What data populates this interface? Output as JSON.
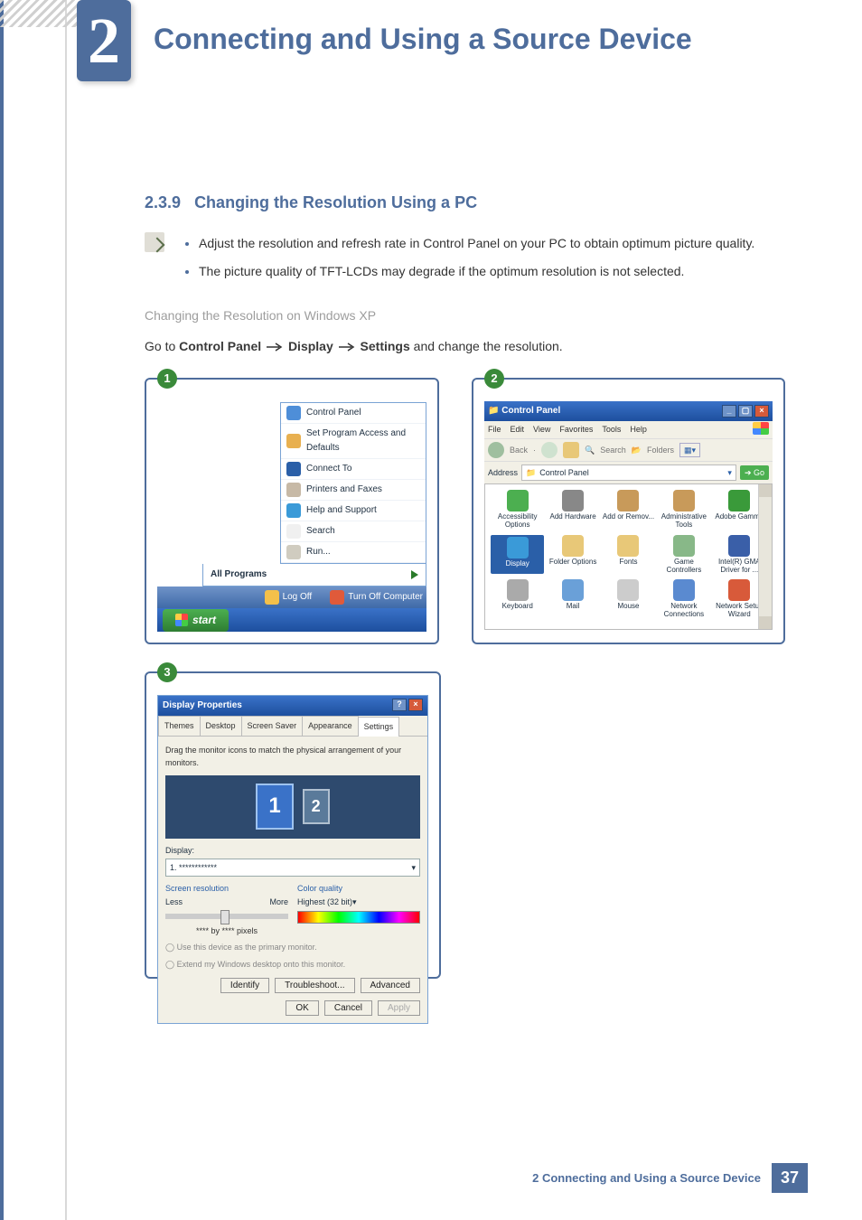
{
  "chapter": {
    "num": "2",
    "title": "Connecting and Using a Source Device"
  },
  "section": {
    "num": "2.3.9",
    "title": "Changing the Resolution Using a PC"
  },
  "bullets": [
    "Adjust the resolution and refresh rate in Control Panel on your PC to obtain optimum picture quality.",
    "The picture quality of TFT-LCDs may degrade if the optimum resolution is not selected."
  ],
  "subhead": "Changing the Resolution on Windows XP",
  "goline": {
    "pre": "Go to ",
    "a": "Control Panel",
    "b": "Display",
    "c": "Settings",
    "post": " and change the resolution."
  },
  "panel1": {
    "badge": "1",
    "menu": [
      {
        "label": "Control Panel",
        "color": "#4e8ed8"
      },
      {
        "label": "Set Program Access and Defaults",
        "color": "#e8b050"
      },
      {
        "label": "Connect To",
        "color": "#2a5fa8"
      },
      {
        "label": "Printers and Faxes",
        "color": "#c7b9a6"
      },
      {
        "label": "Help and Support",
        "color": "#3a9ad8"
      },
      {
        "label": "Search",
        "color": "#f0f0f0"
      },
      {
        "label": "Run...",
        "color": "#d0ccc0"
      }
    ],
    "allprograms": "All Programs",
    "logoff": "Log Off",
    "turnoff": "Turn Off Computer",
    "start": "start"
  },
  "panel2": {
    "badge": "2",
    "title": "Control Panel",
    "menubar": [
      "File",
      "Edit",
      "View",
      "Favorites",
      "Tools",
      "Help"
    ],
    "back": "Back",
    "search": "Search",
    "folders": "Folders",
    "addr_label": "Address",
    "addr_value": "Control Panel",
    "go": "Go",
    "items": [
      {
        "label": "Accessibility Options",
        "color": "#4caf50"
      },
      {
        "label": "Add Hardware",
        "color": "#888"
      },
      {
        "label": "Add or Remov...",
        "color": "#c89a5a"
      },
      {
        "label": "Administrative Tools",
        "color": "#c89a5a"
      },
      {
        "label": "Adobe Gamma",
        "color": "#3a9a3a"
      },
      {
        "label": "Display",
        "color": "#3a9ad8",
        "selected": true
      },
      {
        "label": "Folder Options",
        "color": "#e8c878"
      },
      {
        "label": "Fonts",
        "color": "#e8c878"
      },
      {
        "label": "Game Controllers",
        "color": "#88b888"
      },
      {
        "label": "Intel(R) GMA Driver for ...",
        "color": "#3a5fa8"
      },
      {
        "label": "Keyboard",
        "color": "#aaa"
      },
      {
        "label": "Mail",
        "color": "#6aa0d8"
      },
      {
        "label": "Mouse",
        "color": "#ccc"
      },
      {
        "label": "Network Connections",
        "color": "#5a8ad0"
      },
      {
        "label": "Network Setup Wizard",
        "color": "#d85a3a"
      }
    ]
  },
  "panel3": {
    "badge": "3",
    "title": "Display Properties",
    "tabs": [
      "Themes",
      "Desktop",
      "Screen Saver",
      "Appearance",
      "Settings"
    ],
    "active_tab": 4,
    "hint": "Drag the monitor icons to match the physical arrangement of your monitors.",
    "mon1": "1",
    "mon2": "2",
    "display_label": "Display:",
    "display_value": "1. ************",
    "res_label": "Screen resolution",
    "res_less": "Less",
    "res_more": "More",
    "res_value": "**** by **** pixels",
    "cq_label": "Color quality",
    "cq_value": "Highest (32 bit)",
    "chk1": "Use this device as the primary monitor.",
    "chk2": "Extend my Windows desktop onto this monitor.",
    "btn_identify": "Identify",
    "btn_trouble": "Troubleshoot...",
    "btn_adv": "Advanced",
    "btn_ok": "OK",
    "btn_cancel": "Cancel",
    "btn_apply": "Apply"
  },
  "footer": {
    "text": "2 Connecting and Using a Source Device",
    "page": "37"
  }
}
